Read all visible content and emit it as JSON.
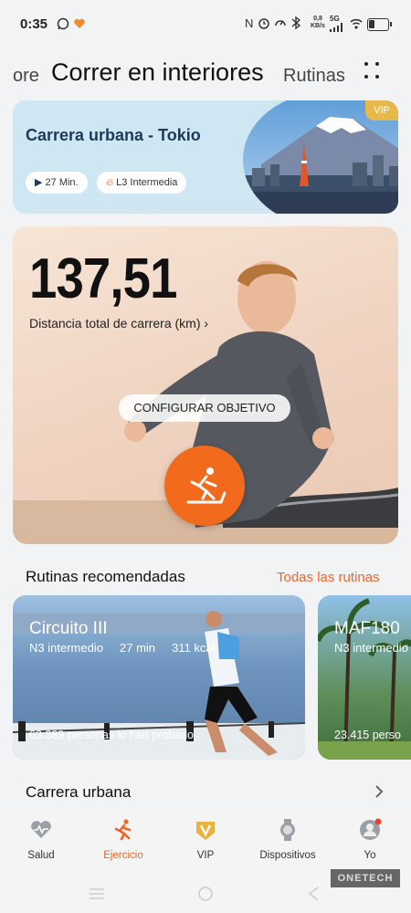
{
  "status": {
    "time": "0:35",
    "net_speed": "0,8",
    "net_unit": "KB/s",
    "net_type": "5G",
    "battery_level": 0.35
  },
  "tabs": {
    "prev": "ore",
    "active": "Correr en interiores",
    "next": "Rutinas"
  },
  "featured": {
    "title": "Carrera urbana - Tokio",
    "duration": "27 Min.",
    "level": "L3 Intermedia",
    "badge": "VIP"
  },
  "stats": {
    "distance_value": "137,51",
    "distance_label": "Distancia total de carrera (km)",
    "goal_button": "CONFIGURAR OBJETIVO"
  },
  "recommended": {
    "title": "Rutinas recomendadas",
    "all_link": "Todas las rutinas",
    "cards": [
      {
        "name": "Circuito III",
        "level": "N3 intermedio",
        "duration": "27 min",
        "kcal": "311 kcal",
        "tried": "63.389 personas lo han probado"
      },
      {
        "name": "MAF180",
        "level": "N3 intermedio",
        "tried": "23.415 perso"
      }
    ]
  },
  "urban": {
    "title": "Carrera urbana"
  },
  "nav": {
    "items": [
      {
        "label": "Salud",
        "icon": "heart-pulse-icon"
      },
      {
        "label": "Ejercicio",
        "icon": "runner-icon"
      },
      {
        "label": "VIP",
        "icon": "vip-icon"
      },
      {
        "label": "Dispositivos",
        "icon": "watch-icon"
      },
      {
        "label": "Yo",
        "icon": "profile-icon"
      }
    ],
    "active_color": "#f0652a"
  },
  "watermark": "ONETECH"
}
